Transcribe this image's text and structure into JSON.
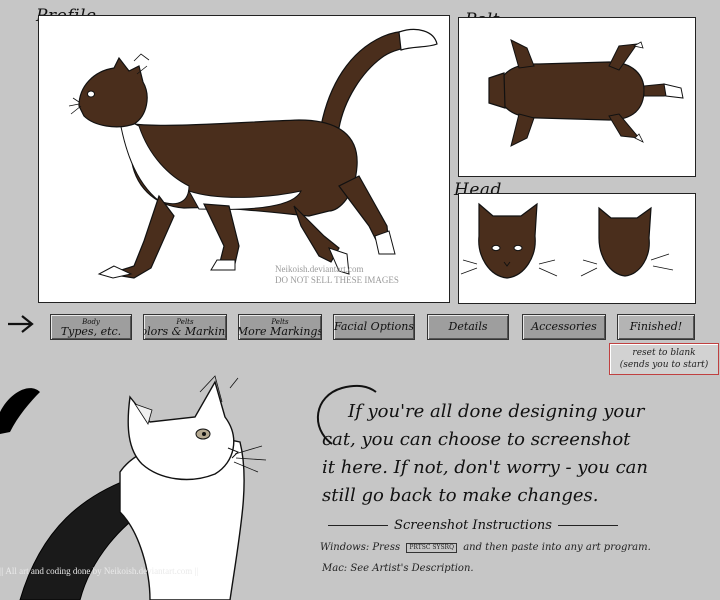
{
  "panels": {
    "profile_label": "Profile",
    "pelt_label": "Pelt",
    "head_label": "Head"
  },
  "watermark": {
    "line1": "Neikoish.deviantart.com",
    "line2": "DO NOT SELL THESE IMAGES"
  },
  "tabs": [
    {
      "top": "Body",
      "main": "Types, etc."
    },
    {
      "top": "Pelts",
      "main": "Colors & Markings"
    },
    {
      "top": "Pelts",
      "main": "More Markings"
    },
    {
      "top": "",
      "main": "Facial Options"
    },
    {
      "top": "",
      "main": "Details"
    },
    {
      "top": "",
      "main": "Accessories"
    },
    {
      "top": "",
      "main": "Finished!"
    }
  ],
  "reset": {
    "line1": "reset to blank",
    "line2": "(sends you to start)"
  },
  "message": {
    "line1": "If you're all done designing your",
    "line2": "cat, you can choose to screenshot",
    "line3": "it here. If not, don't worry - you can",
    "line4": "still go back to make changes."
  },
  "instructions": {
    "title": "Screenshot Instructions",
    "windows_label": "Windows:",
    "windows_text_a": "Press",
    "key": "PRTSC SYSRQ",
    "windows_text_b": "and then paste into any art program.",
    "mac_label": "Mac:",
    "mac_text": "See Artist's Description."
  },
  "footer": "|| All art and coding done by Neikoish.deviantart.com ||",
  "colors": {
    "background": "#c6c6c6",
    "cat_brown": "#4a2e1c",
    "cat_white": "#ffffff",
    "tab_gray": "#9e9e9e"
  }
}
